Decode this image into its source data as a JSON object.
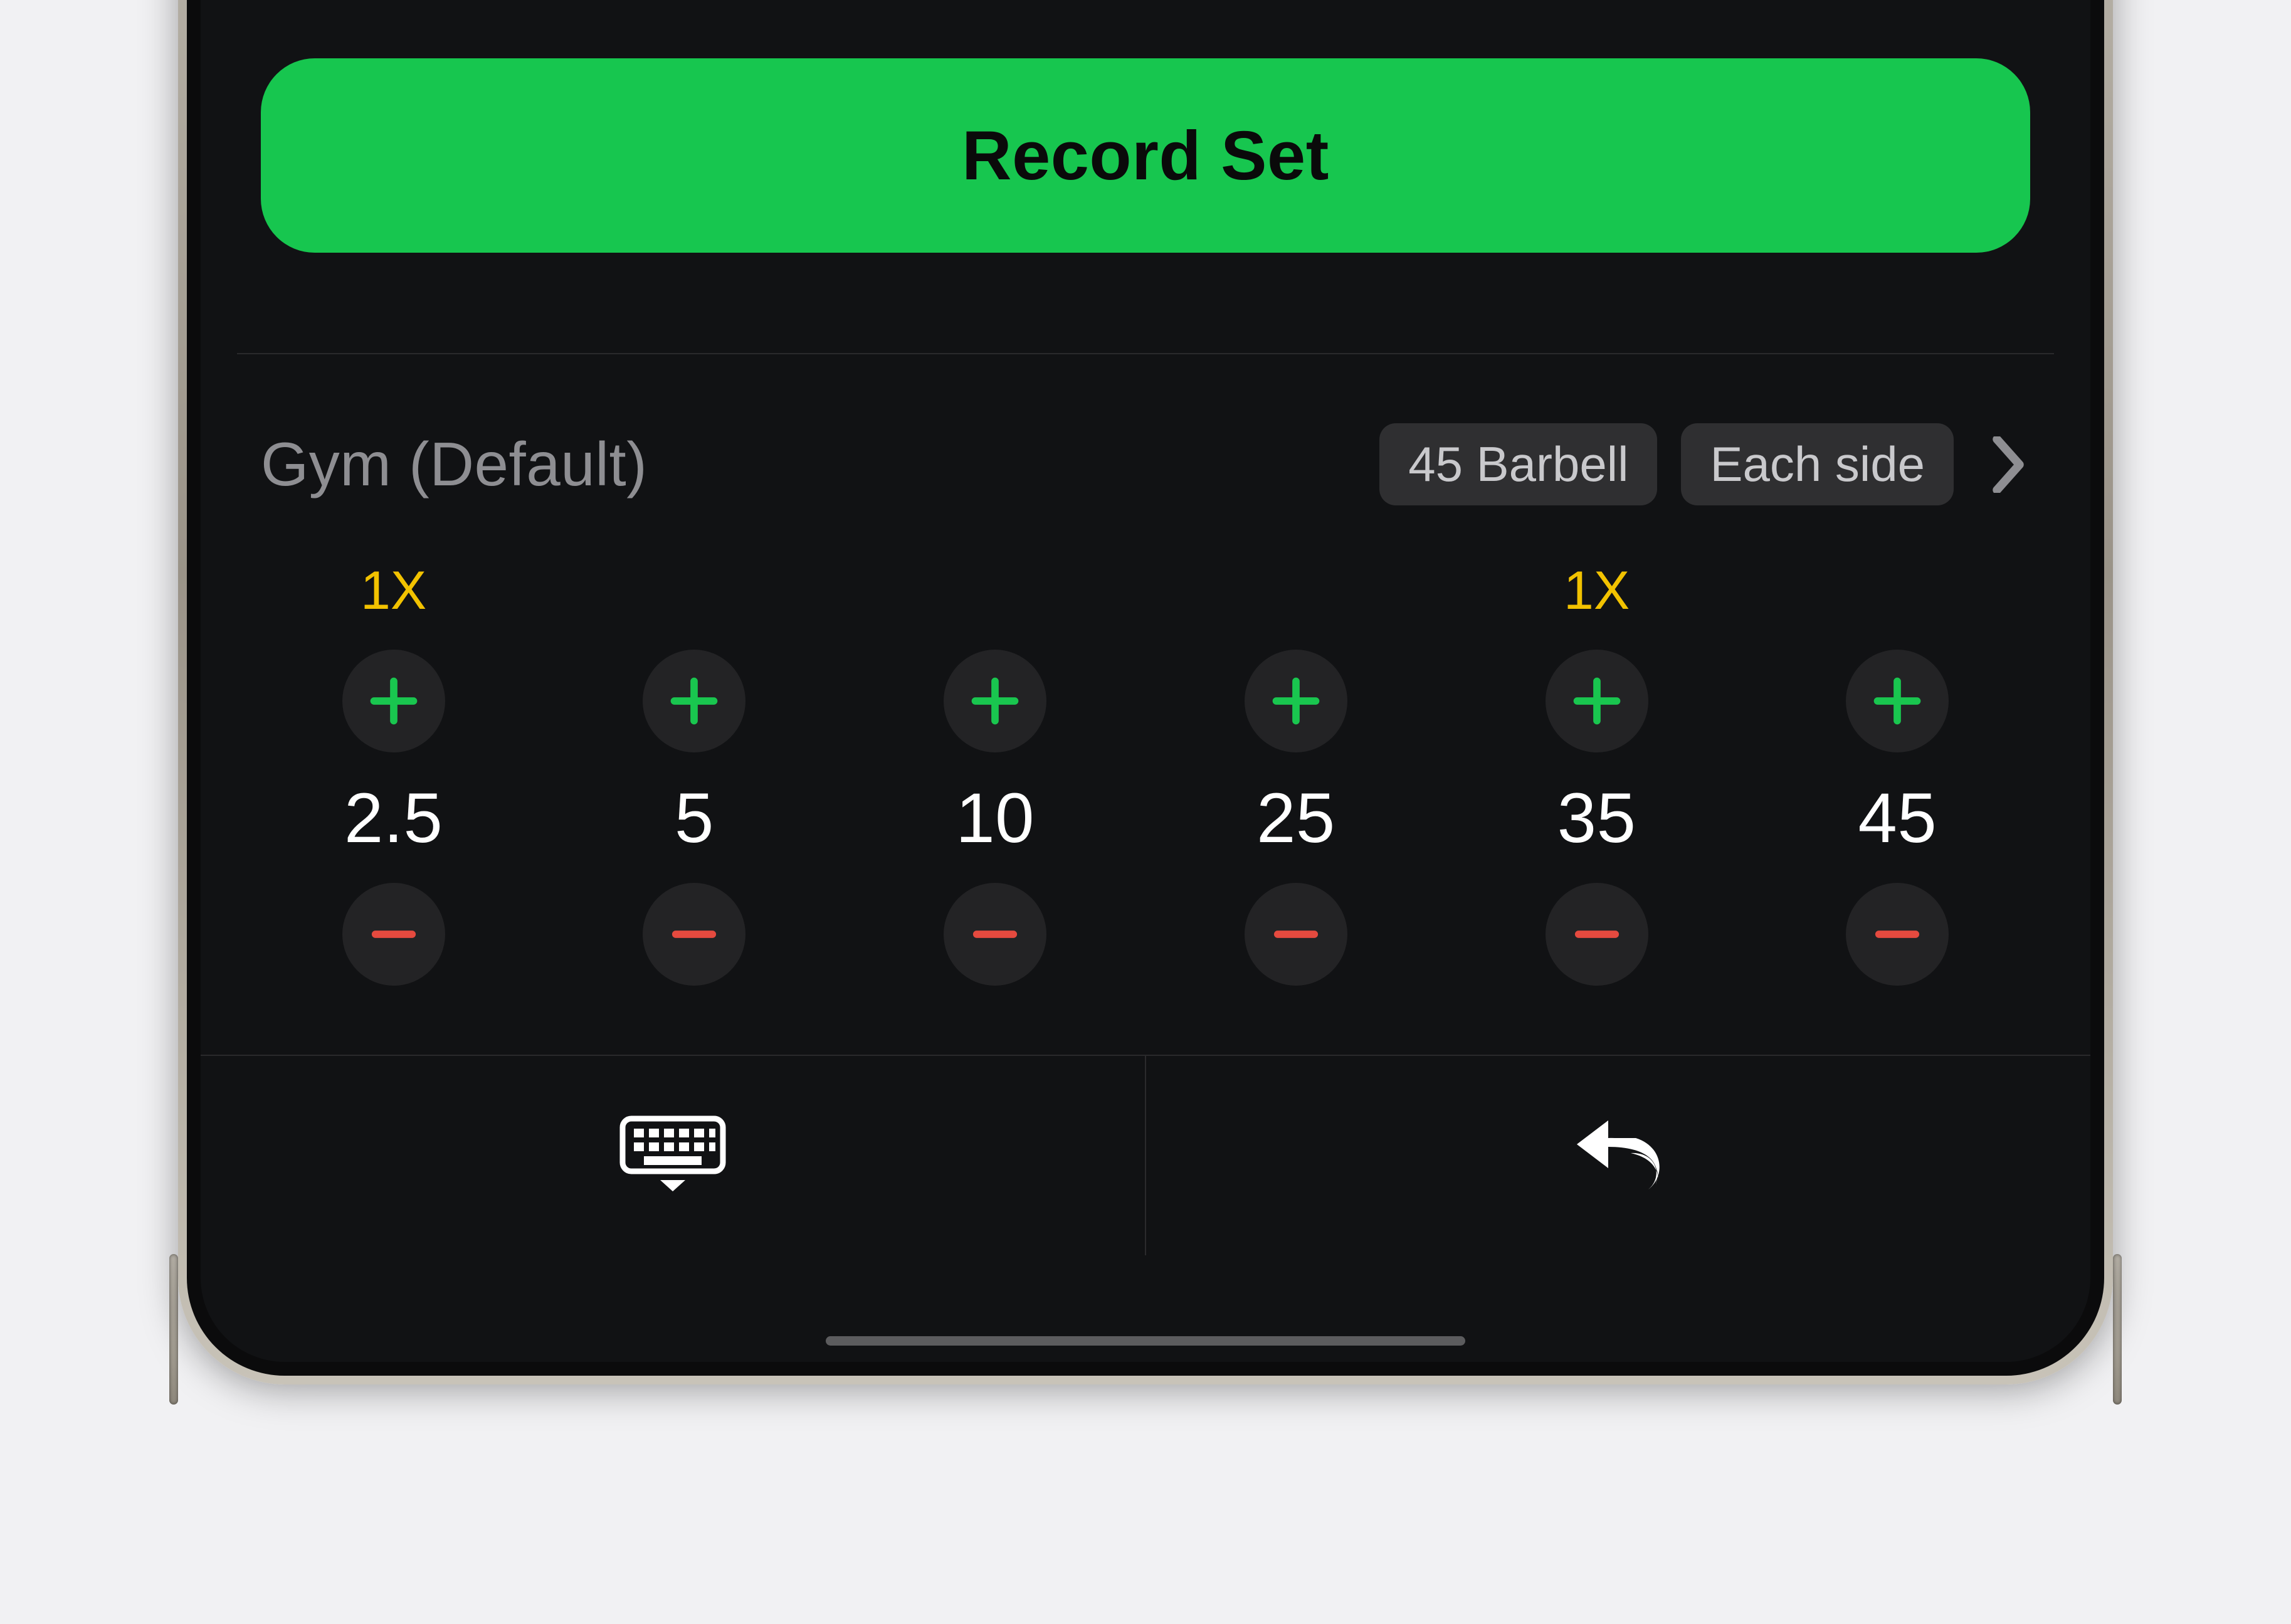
{
  "record_button": {
    "label": "Record Set"
  },
  "plate_picker": {
    "gym_label": "Gym (Default)",
    "chips": {
      "barbell": "45 Barbell",
      "each_side": "Each side"
    },
    "plates": [
      {
        "weight": "2.5",
        "multiplier": "1X"
      },
      {
        "weight": "5",
        "multiplier": ""
      },
      {
        "weight": "10",
        "multiplier": ""
      },
      {
        "weight": "25",
        "multiplier": ""
      },
      {
        "weight": "35",
        "multiplier": "1X"
      },
      {
        "weight": "45",
        "multiplier": ""
      }
    ]
  },
  "colors": {
    "accent_green": "#17c64f",
    "plus_green": "#19c64f",
    "minus_red": "#e54a3f",
    "multiplier_yellow": "#f2c200"
  }
}
